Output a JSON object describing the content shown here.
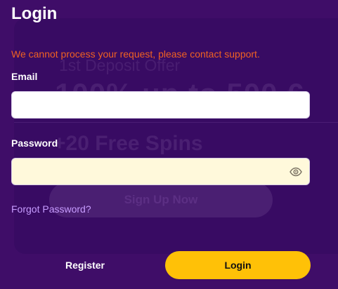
{
  "title": "Login",
  "error_message": "We cannot process your request, please contact support.",
  "form": {
    "email_label": "Email",
    "email_value": "",
    "email_placeholder": "",
    "password_label": "Password",
    "password_value": "",
    "password_placeholder": "",
    "forgot_password": "Forgot Password?",
    "register_label": "Register",
    "login_label": "Login"
  },
  "background_promo": {
    "offer_title": "1st Deposit Offer",
    "offer_amount": "100% up to 500 €",
    "free_spins": "+20 Free Spins",
    "signup_label": "Sign Up Now"
  },
  "icons": {
    "password_toggle": "eye-icon"
  },
  "colors": {
    "background": "#3f0d68",
    "panel": "#380b63",
    "error": "#f06122",
    "link": "#c79cff",
    "primary_button": "#ffc107"
  }
}
